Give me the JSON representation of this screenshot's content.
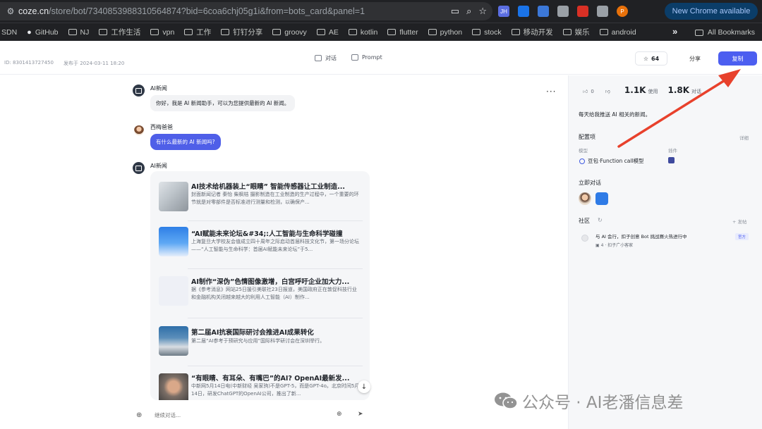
{
  "browser": {
    "url_host": "coze.cn",
    "url_path": "/store/bot/7340853988310564874?bid=6coa6chj05g1i&from=bots_card&panel=1",
    "update_button": "New Chrome available",
    "extensions": [
      {
        "icon": "jh-extension-icon",
        "label": "JH",
        "color": "#5b6ee1"
      },
      {
        "icon": "blue-square-extension-icon",
        "label": "",
        "color": "#1a73e8"
      },
      {
        "icon": "translate-extension-icon",
        "label": "",
        "color": "#3c78d8"
      },
      {
        "icon": "mask-extension-icon",
        "label": "",
        "color": "#9aa0a6"
      },
      {
        "icon": "red-shield-extension-icon",
        "label": "",
        "color": "#d93025"
      },
      {
        "icon": "puzzle-extensions-icon",
        "label": "",
        "color": "#9aa0a6"
      },
      {
        "icon": "profile-avatar-icon",
        "label": "P",
        "color": "#e8710a"
      }
    ]
  },
  "bookmarks": {
    "items": [
      "SDN",
      "GitHub",
      "NJ",
      "工作生活",
      "vpn",
      "工作",
      "钉钉分享",
      "groovy",
      "AE",
      "kotlin",
      "flutter",
      "python",
      "stock",
      "移动开发",
      "娱乐",
      "android"
    ],
    "more": "»",
    "all": "All Bookmarks"
  },
  "header": {
    "bot_id": "ID: 8301413727450",
    "published": "发布于 2024-03-11 18:20",
    "tab_chat": "对话",
    "tab_prompt": "Prompt",
    "star_count": "64",
    "share": "分享",
    "copy": "复制"
  },
  "chat": {
    "bot_name": "AI新闻",
    "greeting": "你好，我是 AI 新闻助手，可以为您提供最新的 AI 新闻。",
    "user_name": "西梅爸爸",
    "user_message": "有什么最新的 AI 新闻吗?",
    "news": [
      {
        "title": "AI技术给机器装上“眼睛” 智能传感器让工业制造...",
        "desc": "封面新闻记者 秦怡 柴枫桔 摄影制造在工业制造的生产过程中，一个重要的环节就是对零部件是否标准进行测量和检测，以确保产..."
      },
      {
        "title": "“AI赋能未来论坛&#34;:人工智能与生命科学碰撞",
        "desc": "上海复旦大学校友会值成立四十周年之际启动首届科技文化节，第一场分论坛——“人工智能与生命科学：首届AI赋能未来论坛”于5..."
      },
      {
        "title": "AI制作“深伪”色情图像激增，白宫呼吁企业加大力...",
        "desc": "据《参考消息》网站25日援引美联社23日报道，美国政府正在敦促科技行业和金融机构关闭越来越大的利用人工智能（AI）制作..."
      },
      {
        "title": "第二届AI抗衰国际研讨会推进AI成果转化",
        "desc": "第二届“AI参考于预研究与应用”国际科学研讨会在深圳举行。"
      },
      {
        "title": "“有眼睛、有耳朵、有嘴巴”的AI? OpenAI最新发...",
        "desc": "中新网5月14日电(中新财经 吴家驹)不是GPT-5，而是GPT-4o。北京时间5月14日，研发ChatGPT的OpenAI公司，推出了新..."
      }
    ],
    "input_placeholder": "继续对话..."
  },
  "panel": {
    "likes": "0",
    "uses_value": "1.1K",
    "uses_label": "使用",
    "chats_value": "1.8K",
    "chats_label": "对话",
    "description": "每天给我推送 AI 相关的新闻。",
    "config_title": "配置项",
    "config_detail": "详细",
    "model_label": "模型",
    "plugin_label": "插件",
    "model_name": "豆包·Function call模型",
    "quick_chat": "立即对话",
    "community": "社区",
    "post": "+ 发帖",
    "community_post": {
      "title": "与 AI 会行，扣子创意 Bot 挑战赛火热进行中",
      "sub_count": "4",
      "sub_author": "扣子广小客家",
      "tag": "官方"
    }
  },
  "watermark": "公众号 · AI老潘信息差",
  "colors": {
    "accent": "#4c5ef0",
    "arrow": "#e8412c"
  }
}
